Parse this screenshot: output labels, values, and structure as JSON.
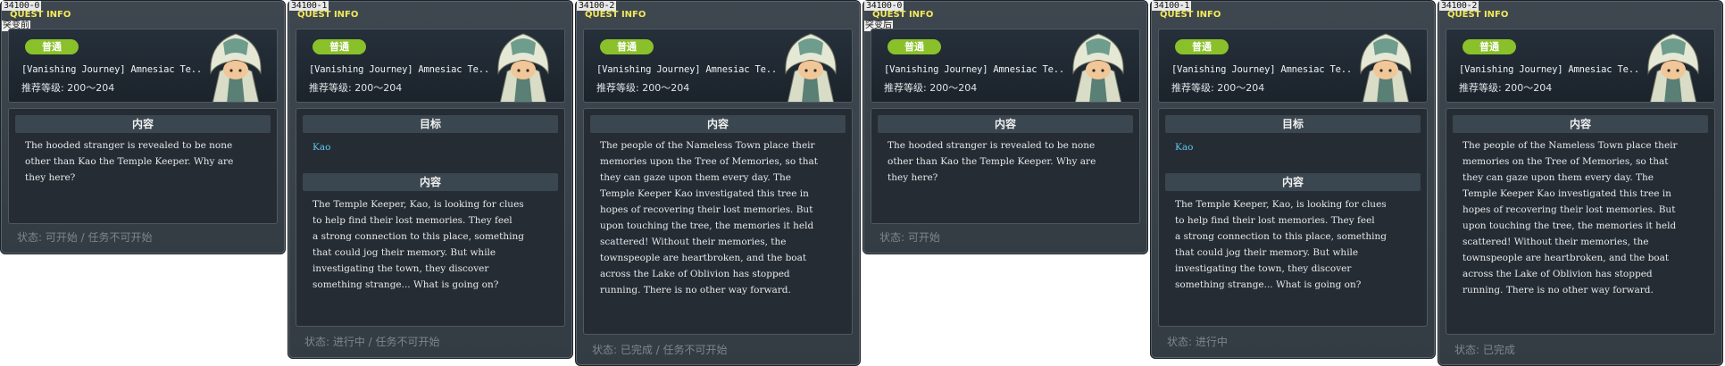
{
  "panels": [
    {
      "id": "34100-0",
      "window_title": "QUEST INFO",
      "stage_note": "突变前",
      "badge": "普通",
      "quest_name": "[Vanishing Journey] Amnesiac Te..",
      "level": "推荐等级: 200〜204",
      "sections": [
        {
          "heading": "内容",
          "text": "The hooded stranger is revealed to be none\nother than Kao the Temple Keeper. Why are\nthey here?"
        }
      ],
      "status": "状态: 可开始 / 任务不可开始"
    },
    {
      "id": "34100-1",
      "window_title": "QUEST INFO",
      "badge": "普通",
      "quest_name": "[Vanishing Journey] Amnesiac Te..",
      "level": "推荐等级: 200〜204",
      "goal_heading": "目标",
      "goal_target": "Kao",
      "sections": [
        {
          "heading": "内容",
          "text": "The Temple Keeper, Kao, is looking for clues\nto help find their lost memories. They feel\na strong connection to this place, something\nthat could jog their memory. But while\ninvestigating the town, they discover\nsomething strange... What is going on?"
        }
      ],
      "status": "状态: 进行中 / 任务不可开始"
    },
    {
      "id": "34100-2",
      "window_title": "QUEST INFO",
      "badge": "普通",
      "quest_name": "[Vanishing Journey] Amnesiac Te..",
      "level": "推荐等级: 200〜204",
      "sections": [
        {
          "heading": "内容",
          "text": "The people of the Nameless Town place their\nmemories upon the Tree of Memories, so that\nthey can gaze upon them every day. The\nTemple Keeper Kao investigated this tree in\nhopes of recovering their lost memories. But\nupon touching the tree, the memories it held\nscattered! Without their memories, the\ntownspeople are heartbroken, and the boat\nacross the  Lake of Oblivion has stopped\nrunning. There is no other way forward."
        }
      ],
      "status": "状态: 已完成 / 任务不可开始"
    },
    {
      "id": "34100-0",
      "window_title": "QUEST INFO",
      "stage_note": "突变后",
      "badge": "普通",
      "quest_name": "[Vanishing Journey] Amnesiac Te..",
      "level": "推荐等级: 200〜204",
      "sections": [
        {
          "heading": "内容",
          "text": "The hooded stranger is revealed to be none\nother than Kao the Temple Keeper. Why are\nthey here?"
        }
      ],
      "status": "状态: 可开始"
    },
    {
      "id": "34100-1",
      "window_title": "QUEST INFO",
      "badge": "普通",
      "quest_name": "[Vanishing Journey] Amnesiac Te..",
      "level": "推荐等级: 200〜204",
      "goal_heading": "目标",
      "goal_target": "Kao",
      "sections": [
        {
          "heading": "内容",
          "text": "The Temple Keeper, Kao, is looking for clues\nto help find their lost memories. They feel\na strong connection to this place, something\nthat could jog their memory. But while\ninvestigating the town, they discover\nsomething strange... What is going on?"
        }
      ],
      "status": "状态: 进行中"
    },
    {
      "id": "34100-2",
      "window_title": "QUEST INFO",
      "badge": "普通",
      "quest_name": "[Vanishing Journey] Amnesiac Te..",
      "level": "推荐等级: 200〜204",
      "sections": [
        {
          "heading": "内容",
          "text": "The people of the Nameless Town place their\nmemories on the Tree of Memories, so that\nthey can gaze upon them every day. The\nTemple Keeper Kao investigated this tree in\nhopes of recovering their lost memories. But\nupon touching the tree, the memories it held\nscattered! Without their memories, the\ntownspeople are heartbroken, and the boat\nacross the Lake of Oblivion has stopped\nrunning. There is no other way forward."
        }
      ],
      "status": "状态: 已完成"
    }
  ],
  "colors": {
    "badge": "#8ac02a",
    "window_title": "#f3e95a",
    "goal_target": "#5fc7f0",
    "status": "#7d868d"
  },
  "icons": {
    "portrait": "hooded-temple-keeper-portrait"
  }
}
